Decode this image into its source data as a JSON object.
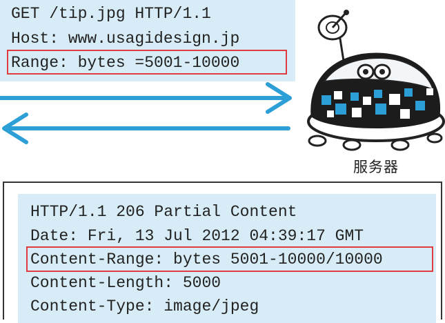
{
  "request": {
    "line1": "GET /tip.jpg HTTP/1.1",
    "line2": "Host: www.usagidesign.jp",
    "line3": "Range: bytes =5001-10000"
  },
  "server": {
    "label": "服务器",
    "icon": "robot-server-icon"
  },
  "response": {
    "line1": "HTTP/1.1 206 Partial Content",
    "line2": "Date: Fri, 13 Jul 2012 04:39:17 GMT",
    "line3": "Content-Range: bytes 5001-10000/10000",
    "line4": "Content-Length: 5000",
    "line5": "Content-Type: image/jpeg"
  },
  "colors": {
    "box_fill": "#d7ecf6",
    "highlight": "#e0393e",
    "arrow": "#2b9fd6"
  }
}
